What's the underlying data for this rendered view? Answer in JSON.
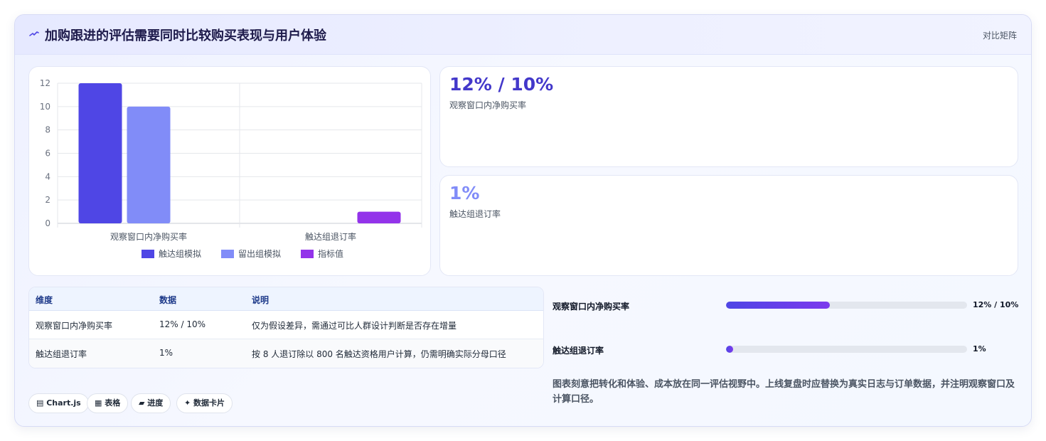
{
  "header": {
    "title": "加购跟进的评估需要同时比较购买表现与用户体验",
    "link": "对比矩阵",
    "icon": "sparkline-icon"
  },
  "colors": {
    "series1": "#4f46e5",
    "series2": "#818cf8",
    "series3": "#9333ea",
    "accent_value": "#4338ca",
    "accent_value_light": "#818cf8"
  },
  "chart_data": {
    "type": "bar",
    "categories": [
      "观察窗口内净购买率",
      "触达组退订率"
    ],
    "series": [
      {
        "name": "触达组模拟",
        "values": [
          12,
          null
        ]
      },
      {
        "name": "留出组模拟",
        "values": [
          10,
          null
        ]
      },
      {
        "name": "指标值",
        "values": [
          null,
          1
        ]
      }
    ],
    "y_ticks": [
      "0",
      "2",
      "4",
      "6",
      "8",
      "10",
      "12"
    ],
    "ylim": [
      0,
      12
    ],
    "grid": true,
    "legend": "bottom"
  },
  "stats": [
    {
      "value": "12% / 10%",
      "label": "观察窗口内净购买率"
    },
    {
      "value": "1%",
      "label": "触达组退订率"
    }
  ],
  "table": {
    "headers": [
      "维度",
      "数据",
      "说明"
    ],
    "rows": [
      [
        "观察窗口内净购买率",
        "12% / 10%",
        "仅为假设差异，需通过可比人群设计判断是否存在增量"
      ],
      [
        "触达组退订率",
        "1%",
        "按 8 人退订除以 800 名触达资格用户计算，仍需明确实际分母口径"
      ]
    ]
  },
  "chips": [
    "▤ Chart.js",
    "▦ 表格",
    "▰ 进度",
    "✦ 数据卡片"
  ],
  "progress": [
    {
      "label": "观察窗口内净购买率",
      "value": "12% / 10%",
      "fill": 0.43
    },
    {
      "label": "触达组退订率",
      "value": "1%",
      "fill": 0.03
    }
  ],
  "note": "图表刻意把转化和体验、成本放在同一评估视野中。上线复盘时应替换为真实日志与订单数据，并注明观察窗口及计算口径。"
}
